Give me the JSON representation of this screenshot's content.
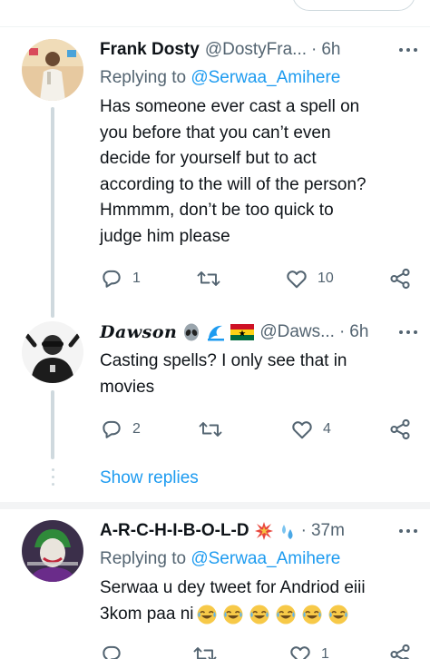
{
  "tweets": [
    {
      "name": "Frank Dosty",
      "handle": "@DostyFra...",
      "dot": "·",
      "time": "6h",
      "replying_prefix": "Replying to",
      "replying_to": "@Serwaa_Amihere",
      "text_lines": [
        "Has someone ever cast a spell on",
        "you before that you can’t even",
        "decide for yourself but to act",
        "according to the will of the person?",
        "Hmmmm, don’t be too quick to",
        "judge him please"
      ],
      "replies": "1",
      "retweets": "",
      "likes": "10"
    },
    {
      "name": "Dawson",
      "name_emojis": [
        "alien-emoji",
        "wave-emoji",
        "ghana-flag-emoji"
      ],
      "handle": "@Daws...",
      "dot": "·",
      "time": "6h",
      "text_lines": [
        "Casting spells? I only see that in",
        "movies"
      ],
      "replies": "2",
      "retweets": "",
      "likes": "4"
    },
    {
      "name": "A-R-C-H-I-B-O-L-D",
      "name_emojis": [
        "collision-emoji",
        "sweat-droplets-emoji"
      ],
      "handle": "",
      "dot": "·",
      "time": "37m",
      "replying_prefix": "Replying to",
      "replying_to": "@Serwaa_Amihere",
      "text_lines": [
        "Serwaa u dey tweet for Andriod eiii",
        "3kom paa ni"
      ],
      "trailing_emojis": [
        "joy-emoji",
        "joy-emoji",
        "joy-emoji",
        "joy-emoji",
        "joy-emoji",
        "joy-emoji"
      ],
      "replies": "",
      "retweets": "",
      "likes": "1"
    }
  ],
  "show_replies": "Show replies",
  "colors": {
    "accent": "#1d9bf0",
    "secondary_text": "#536471",
    "primary_text": "#0f1419",
    "divider": "#eff3f4"
  }
}
